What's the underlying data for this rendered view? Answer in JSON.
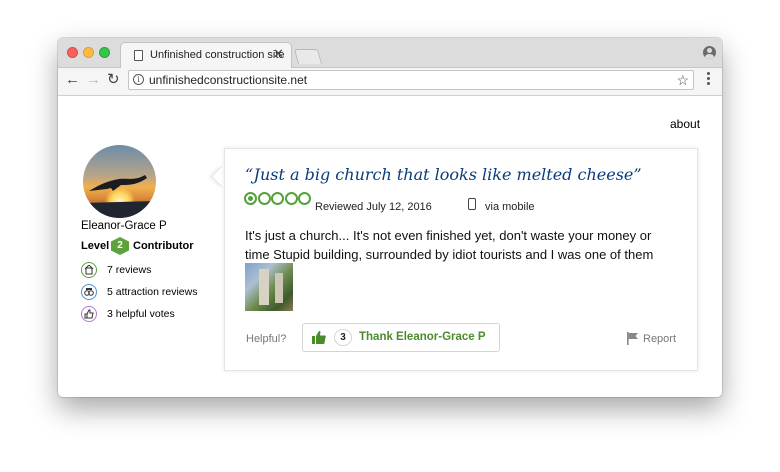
{
  "browser": {
    "tab_title": "Unfinished construction site",
    "tab_close": "✕",
    "url": "unfinishedconstructionsite.net",
    "back": "←",
    "forward": "→",
    "reload": "↻",
    "star": "☆"
  },
  "page": {
    "nav_about": "about"
  },
  "reviewer": {
    "name": "Eleanor-Grace P",
    "level_label": "Level",
    "level": "2",
    "level_title": "Contributor",
    "stats": [
      {
        "label": "7 reviews",
        "icon": "reviews-icon"
      },
      {
        "label": "5 attraction reviews",
        "icon": "attraction-icon"
      },
      {
        "label": "3 helpful votes",
        "icon": "helpful-votes-icon"
      }
    ]
  },
  "review": {
    "title": "“Just a big church that looks like melted cheese”",
    "rating": 1,
    "rating_max": 5,
    "reviewed": "Reviewed July 12, 2016",
    "via": "via mobile",
    "body": "It's just a church... It's not even finished yet, don't waste your money or time Stupid building, surrounded by idiot tourists and I was one of them",
    "helpful_label": "Helpful?",
    "thank_count": "3",
    "thank_label": "Thank Eleanor-Grace P",
    "report_label": "Report"
  },
  "colors": {
    "accent_green": "#4a8c2a",
    "title_blue": "#0a3c7c"
  }
}
